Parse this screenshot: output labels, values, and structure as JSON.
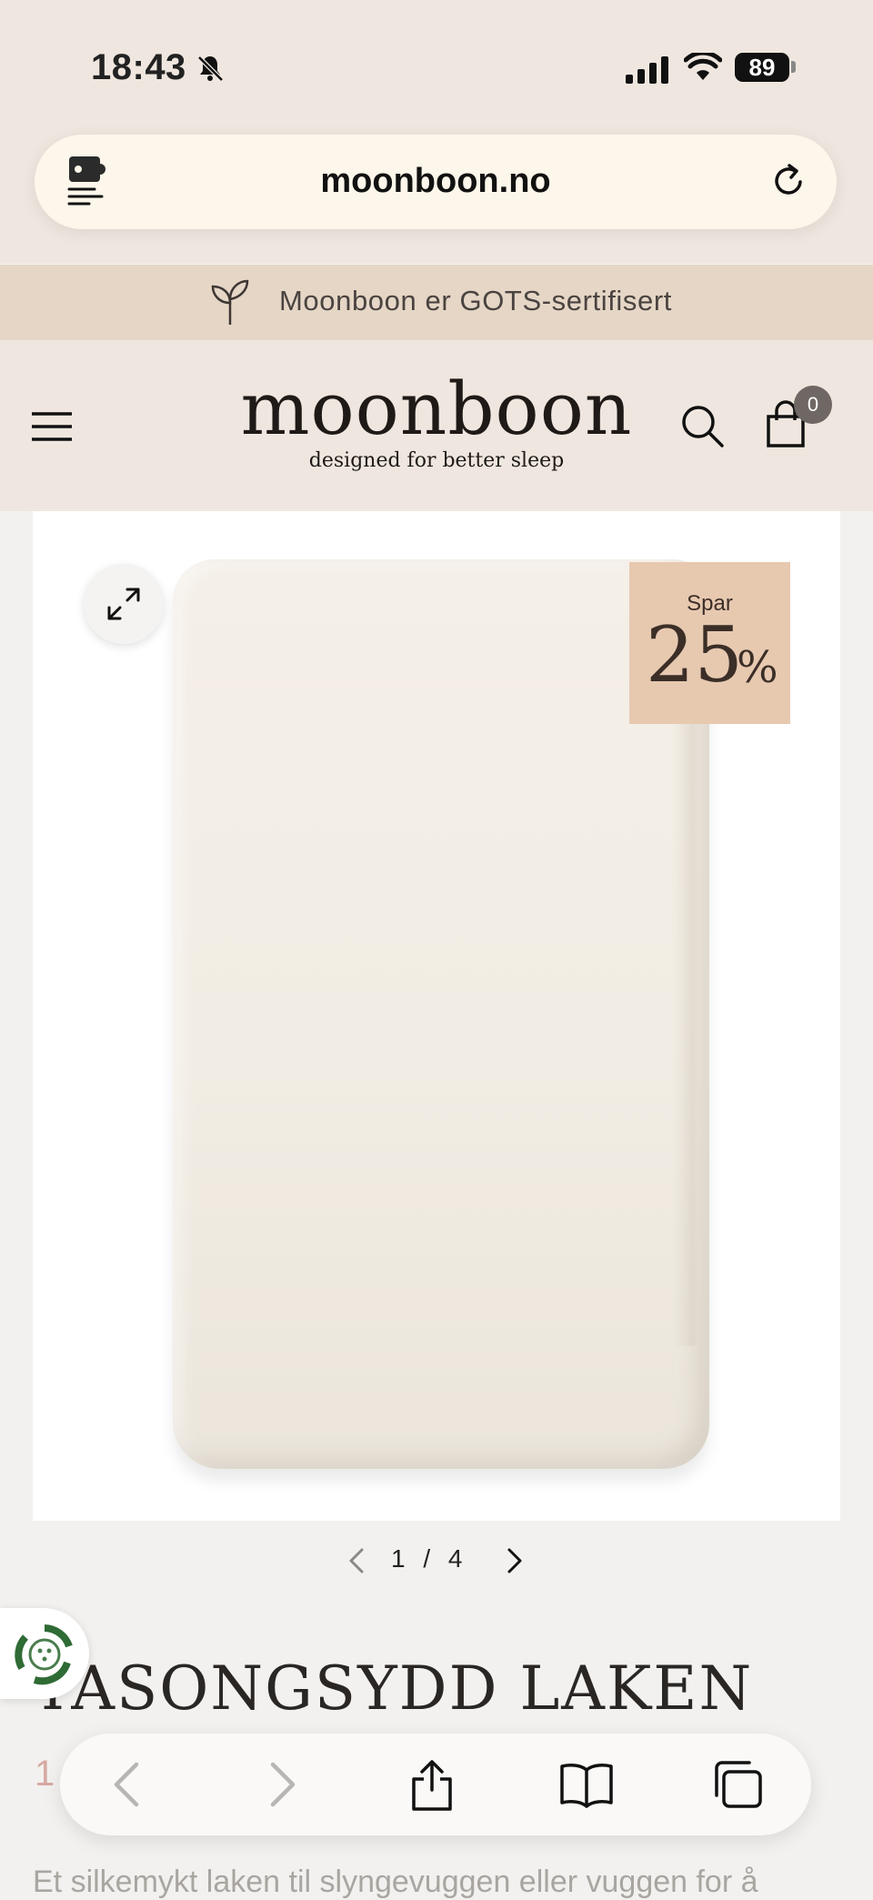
{
  "status_bar": {
    "time": "18:43",
    "battery": "89",
    "icons": [
      "bell-slash-icon",
      "cellular-signal-icon",
      "wifi-icon",
      "battery-icon"
    ]
  },
  "browser": {
    "url": "moonboon.no",
    "left_icon": "reader-extension-icon",
    "right_icon": "reload-icon"
  },
  "promo_banner": {
    "icon": "leaf-sprout-icon",
    "text": "Moonboon er GOTS-sertifisert"
  },
  "header": {
    "logo": "moonboon",
    "tagline": "designed for better sleep",
    "cart_count": "0"
  },
  "gallery": {
    "badge_label": "Spar",
    "badge_value": "25",
    "badge_unit": "%",
    "current": "1",
    "separator": "/",
    "total": "4",
    "pager_text": "1 / 4"
  },
  "product": {
    "title": "TASONGSYDD LAKEN",
    "price_visible": "1",
    "description_partial": "Et silkemykt laken til slyngevuggen eller vuggen for å"
  },
  "colors": {
    "beige_bg": "#efe7df",
    "promo_bg": "#e5d6c6",
    "sale_badge": "#e7c9b0",
    "price": "#c47a72"
  }
}
